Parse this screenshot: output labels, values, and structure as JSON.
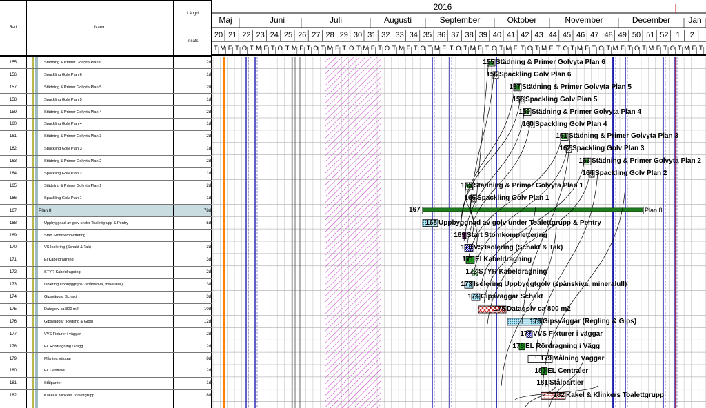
{
  "columns": {
    "row": "Rad",
    "name": "Namn",
    "duration": "Längd",
    "effort": "Insats"
  },
  "timeline": {
    "year": "2016",
    "months": [
      "Maj",
      "Juni",
      "Juli",
      "Augusti",
      "September",
      "Oktober",
      "November",
      "December",
      "Jan"
    ],
    "weeks": [
      "20",
      "21",
      "22",
      "23",
      "24",
      "25",
      "26",
      "27",
      "28",
      "29",
      "30",
      "31",
      "32",
      "33",
      "34",
      "35",
      "36",
      "37",
      "38",
      "39",
      "40",
      "41",
      "42",
      "43",
      "44",
      "45",
      "46",
      "47",
      "48",
      "49",
      "50",
      "51",
      "52",
      "1",
      "2"
    ],
    "day_letters": [
      "T",
      "M",
      "F",
      "T",
      "O",
      "T",
      "M",
      "F",
      "T",
      "O",
      "T",
      "M",
      "F",
      "T",
      "O",
      "T",
      "M",
      "F",
      "T",
      "O",
      "T",
      "M",
      "F",
      "T",
      "O",
      "T",
      "M",
      "F",
      "T",
      "O",
      "T",
      "M",
      "F",
      "T",
      "O",
      "T",
      "M",
      "F",
      "T",
      "O",
      "T",
      "M",
      "F",
      "T",
      "O",
      "T",
      "M",
      "F",
      "T",
      "O",
      "T",
      "M",
      "F",
      "T",
      "O",
      "T",
      "M",
      "F",
      "T",
      "O",
      "T",
      "M",
      "F",
      "T",
      "O",
      "T",
      "M",
      "F",
      "T",
      "O",
      "T",
      "M"
    ]
  },
  "rows": [
    {
      "num": "155",
      "name": "Städning & Primer Golvyta Plan 6",
      "dur": "2d"
    },
    {
      "num": "156",
      "name": "Spackling Golv Plan 6",
      "dur": "1d"
    },
    {
      "num": "157",
      "name": "Städning & Primer Golvyta Plan 5",
      "dur": "2d"
    },
    {
      "num": "158",
      "name": "Spackling Golv Plan 5",
      "dur": "1d"
    },
    {
      "num": "159",
      "name": "Städning & Primer Golvyta Plan 4",
      "dur": "2d"
    },
    {
      "num": "160",
      "name": "Spackling Golv Plan 4",
      "dur": "1d"
    },
    {
      "num": "161",
      "name": "Städning & Primer Golvyta Plan 3",
      "dur": "2d"
    },
    {
      "num": "162",
      "name": "Spackling Golv Plan 3",
      "dur": "1d"
    },
    {
      "num": "163",
      "name": "Städning & Primer Golvyta Plan 2",
      "dur": "2d"
    },
    {
      "num": "164",
      "name": "Spackling Golv Plan 2",
      "dur": "1d"
    },
    {
      "num": "165",
      "name": "Städning & Primer Golvyta Plan 1",
      "dur": "2d"
    },
    {
      "num": "166",
      "name": "Spackling Golv Plan 1",
      "dur": "1d"
    },
    {
      "num": "167",
      "name": "Plan 8",
      "dur": "78d",
      "summary": true
    },
    {
      "num": "168",
      "name": "Uppbyggnad av golv under Toalettgrupp & Pentry",
      "dur": "5d"
    },
    {
      "num": "169",
      "name": "Start Stomkomplettering",
      "dur": ""
    },
    {
      "num": "170",
      "name": "VS Isolering (Schakt & Tak)",
      "dur": "3d"
    },
    {
      "num": "171",
      "name": "El Kabeldragning",
      "dur": "3d"
    },
    {
      "num": "172",
      "name": "STYR Kabeldragning",
      "dur": "2d"
    },
    {
      "num": "173",
      "name": "Isolering Uppbyggtgolv (spånskiva, mineralull)",
      "dur": "3d"
    },
    {
      "num": "174",
      "name": "Gipsväggar Schakt",
      "dur": "3d"
    },
    {
      "num": "175",
      "name": "Datagolv ca 800 m2",
      "dur": "10d"
    },
    {
      "num": "176",
      "name": "Gipsväggar (Regling & Gips)",
      "dur": "12d"
    },
    {
      "num": "177",
      "name": "VVS Fixturer i väggar",
      "dur": "2d"
    },
    {
      "num": "178",
      "name": "EL Rördragning i Vägg",
      "dur": "2d"
    },
    {
      "num": "179",
      "name": "Målning Väggar",
      "dur": "8d"
    },
    {
      "num": "180",
      "name": "EL Centraler",
      "dur": "2d"
    },
    {
      "num": "181",
      "name": "Stålpartier",
      "dur": "1d"
    },
    {
      "num": "182",
      "name": "Kakel & Klinkers Toalettgrupp",
      "dur": "8d"
    }
  ],
  "bars": [
    {
      "num": "155",
      "label": "Städning & Primer Golvyta Plan 6",
      "style": "green-box"
    },
    {
      "num": "156",
      "label": "Spackling Golv Plan 6",
      "style": "hatch-box"
    },
    {
      "num": "157",
      "label": "Städning & Primer Golvyta Plan 5",
      "style": "green-box"
    },
    {
      "num": "158",
      "label": "Spackling Golv Plan 5",
      "style": "hatch-box"
    },
    {
      "num": "159",
      "label": "Städning & Primer Golvyta Plan 4",
      "style": "green-box"
    },
    {
      "num": "160",
      "label": "Spackling Golv Plan 4",
      "style": "hatch-box"
    },
    {
      "num": "161",
      "label": "Städning & Primer Golvyta Plan 3",
      "style": "green-box"
    },
    {
      "num": "162",
      "label": "Spackling Golv Plan 3",
      "style": "hatch-box"
    },
    {
      "num": "163",
      "label": "Städning & Primer Golvyta Plan 2",
      "style": "green-box"
    },
    {
      "num": "164",
      "label": "Spackling Golv Plan 2",
      "style": "hatch-box"
    },
    {
      "num": "165",
      "label": "Städning & Primer Golvyta Plan 1",
      "style": "green-box"
    },
    {
      "num": "166",
      "label": "Spackling Golv Plan 1",
      "style": "hatch-box"
    },
    {
      "num": "167",
      "label": "Plan 8",
      "style": "summary"
    },
    {
      "num": "168",
      "label": "Uppbyggnad av golv under Toalettgrupp & Pentry",
      "style": "cyan-dots"
    },
    {
      "num": "169",
      "label": "Start Stomkomplettering",
      "style": "milestone"
    },
    {
      "num": "170",
      "label": "VS Isolering (Schakt & Tak)",
      "style": "blue-check"
    },
    {
      "num": "171",
      "label": "El Kabeldragning",
      "style": "green-solid"
    },
    {
      "num": "172",
      "label": "STYR Kabeldragning",
      "style": "green-diag"
    },
    {
      "num": "173",
      "label": "Isolering Uppbyggtgolv (spånskiva, mineralull)",
      "style": "cyan-dots"
    },
    {
      "num": "174",
      "label": "Gipsväggar Schakt",
      "style": "cyan-dots"
    },
    {
      "num": "175",
      "label": "Datagolv ca 800 m2",
      "style": "red-cross"
    },
    {
      "num": "176",
      "label": "Gipsväggar (Regling & Gips)",
      "style": "cyan-dots"
    },
    {
      "num": "177",
      "label": "VVS Fixturer i väggar",
      "style": "blue-check"
    },
    {
      "num": "178",
      "label": "EL Rördragning i Vägg",
      "style": "green-solid"
    },
    {
      "num": "179",
      "label": "Målning Väggar",
      "style": "white"
    },
    {
      "num": "180",
      "label": "EL Centraler",
      "style": "green-solid"
    },
    {
      "num": "181",
      "label": "Stålpartier",
      "style": "white"
    },
    {
      "num": "182",
      "label": "Kakel & Klinkers Toalettgrupp",
      "style": "red-brick"
    }
  ],
  "colors": {
    "summary_row": "#c9dde0",
    "summary_bar": "#1e7b1e",
    "today_line": "#ff7f00",
    "holiday_hatch": "#cc33cc",
    "week_line_blue": "#1f1fb0",
    "red_line": "#e03030"
  }
}
